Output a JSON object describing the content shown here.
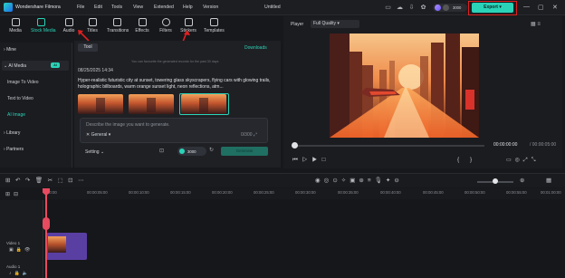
{
  "titlebar": {
    "app_name": "Wondershare Filmora",
    "menus": [
      "File",
      "Edit",
      "Tools",
      "View",
      "Extended",
      "Help",
      "Version"
    ],
    "project_title": "Untitled",
    "credits": "3000",
    "export_label": "Export"
  },
  "media_tabs": [
    {
      "label": "Media",
      "icon": "media-icon"
    },
    {
      "label": "Stock Media",
      "icon": "stock-media-icon",
      "active": true
    },
    {
      "label": "Audio",
      "icon": "music-note-icon"
    },
    {
      "label": "Titles",
      "icon": "text-t-icon"
    },
    {
      "label": "Transitions",
      "icon": "transition-icon"
    },
    {
      "label": "Effects",
      "icon": "effects-icon"
    },
    {
      "label": "Filters",
      "icon": "filter-icon"
    },
    {
      "label": "Stickers",
      "icon": "sticker-icon"
    },
    {
      "label": "Templates",
      "icon": "template-icon"
    }
  ],
  "sidebar": {
    "mine": "Mine",
    "ai_media": "AI Media",
    "ai_badge": "AI",
    "items": [
      "Image To Video",
      "Text to Video",
      "AI Image"
    ],
    "library": "Library",
    "partners": "Partners"
  },
  "center": {
    "tool_label": "Tool",
    "downloads": "Downloads",
    "hint": "You can favourite the generated records for the past 30 days",
    "date": "08/25/2025 14:34",
    "prompt": "Hyper-realistic futuristic city at sunset, towering glass skyscrapers, flying cars with glowing trails, holographic billboards, warm orange sunset light, neon reflections, atm...",
    "describe_placeholder": "Describe the image you want to generate.",
    "style": "General",
    "counter": "0/300",
    "setting": "Setting",
    "cost": "3000",
    "generate": "Generate"
  },
  "player": {
    "label": "Player",
    "quality": "Full Quality",
    "time_current": "00:00:00:00",
    "time_total": "00:00:05:00"
  },
  "timeline": {
    "ticks": [
      "00:00",
      "00:00:05:00",
      "00:00:10:00",
      "00:00:15:00",
      "00:00:20:00",
      "00:00:25:00",
      "00:00:30:00",
      "00:00:35:00",
      "00:00:40:00",
      "00:00:45:00",
      "00:00:50:00",
      "00:00:55:00",
      "00:01:00:00"
    ],
    "video_track": "Video 1",
    "audio_track": "Audio 1"
  },
  "colors": {
    "accent": "#2ad3b8",
    "annotation_red": "#e02020",
    "clip": "#5a3fa3",
    "playhead": "#e84a5f"
  }
}
